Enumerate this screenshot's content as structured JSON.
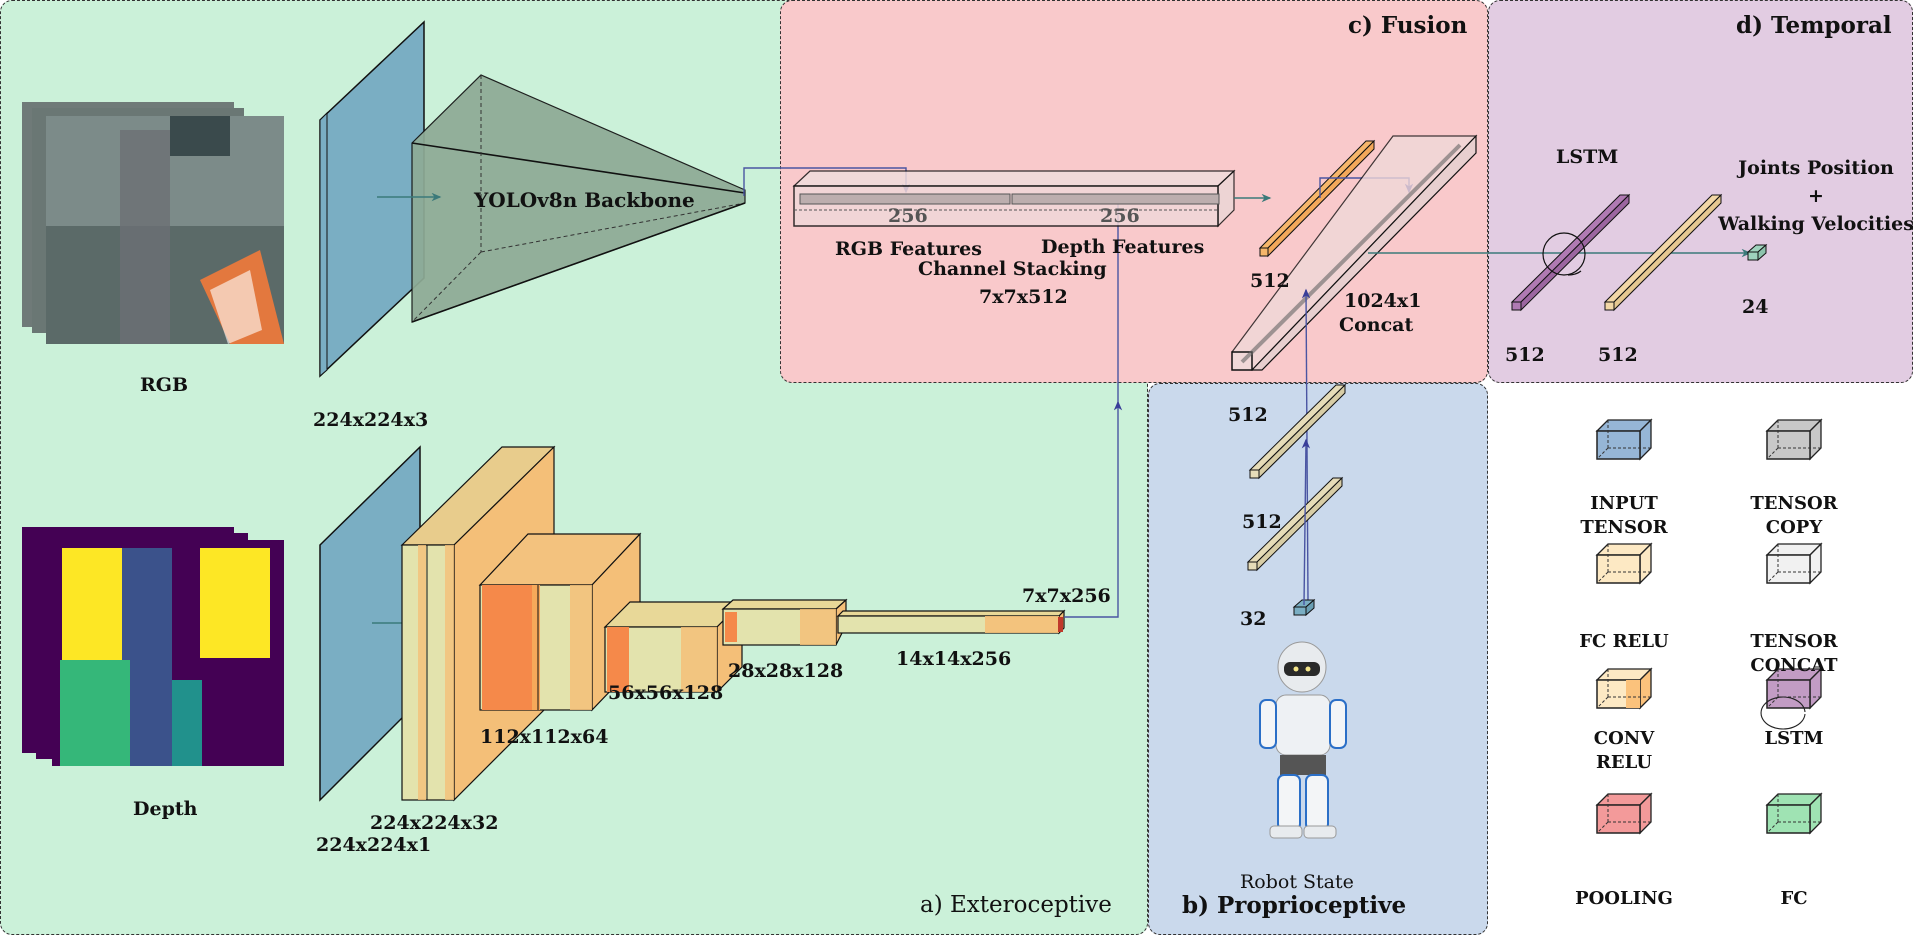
{
  "panels": {
    "exteroceptive": "a) Exteroceptive",
    "proprioceptive": "b) Proprioceptive",
    "fusion": "c) Fusion",
    "temporal": "d) Temporal"
  },
  "colors": {
    "exteroceptive_bg": "#cbf1d9",
    "fusion_bg": "#f9c9cb",
    "temporal_bg": "#e2cce2",
    "proprioceptive_bg": "#cad9ec",
    "input_tensor": "#7aaec3",
    "backbone": "#8eab96",
    "conv_light": "#e3e3ad",
    "conv_orange": "#f4bf78",
    "conv_dark": "#f5894a",
    "fc_relu": "#f2d7a6",
    "fc_orange": "#f6b66a",
    "lstm": "#a571a8",
    "fc_out": "#9fd3bd",
    "arrow_blue": "#3a3e99",
    "arrow_teal": "#3b7a7a"
  },
  "exteroceptive": {
    "rgb_label": "RGB",
    "depth_label": "Depth",
    "rgb_input_dims": "224x224x3",
    "backbone_label": "YOLOv8n Backbone",
    "depth_input_dims": "224x224x1",
    "conv_layers": [
      "224x224x32",
      "112x112x64",
      "56x56x128",
      "28x28x128",
      "14x14x256",
      "7x7x256"
    ]
  },
  "fusion": {
    "rgb_features": "RGB Features",
    "depth_features": "Depth Features",
    "rgb_channels": "256",
    "depth_channels": "256",
    "stacking_label": "Channel Stacking",
    "stacking_dims": "7x7x512",
    "fc_dims": "512",
    "concat_dims": "1024x1",
    "concat_label": "Concat"
  },
  "proprioceptive": {
    "fc1_dims": "512",
    "fc2_dims": "512",
    "input_dims": "32",
    "robot_label": "Robot State"
  },
  "temporal": {
    "lstm_label": "LSTM",
    "lstm_dims": "512",
    "fc_dims": "512",
    "output_dims": "24",
    "output_line1": "Joints Position",
    "output_plus": "+",
    "output_line2": "Walking Velocities"
  },
  "legend": [
    {
      "label": "INPUT\nTENSOR",
      "lines": [
        "INPUT",
        "TENSOR"
      ],
      "icon": "input-tensor-cube"
    },
    {
      "label": "TENSOR COPY",
      "lines": [
        "TENSOR",
        "COPY"
      ],
      "icon": "tensor-copy-cube"
    },
    {
      "label": "FC RELU",
      "lines": [
        "FC RELU"
      ],
      "icon": "fc-relu-cube"
    },
    {
      "label": "TENSOR CONCAT",
      "lines": [
        "TENSOR",
        "CONCAT"
      ],
      "icon": "tensor-concat-cube"
    },
    {
      "label": "CONV RELU",
      "lines": [
        "CONV",
        "RELU"
      ],
      "icon": "conv-relu-cube"
    },
    {
      "label": "LSTM",
      "lines": [
        "LSTM"
      ],
      "icon": "lstm-cube"
    },
    {
      "label": "POOLING",
      "lines": [
        "POOLING"
      ],
      "icon": "pooling-cube"
    },
    {
      "label": "FC",
      "lines": [
        "FC"
      ],
      "icon": "fc-cube"
    }
  ]
}
